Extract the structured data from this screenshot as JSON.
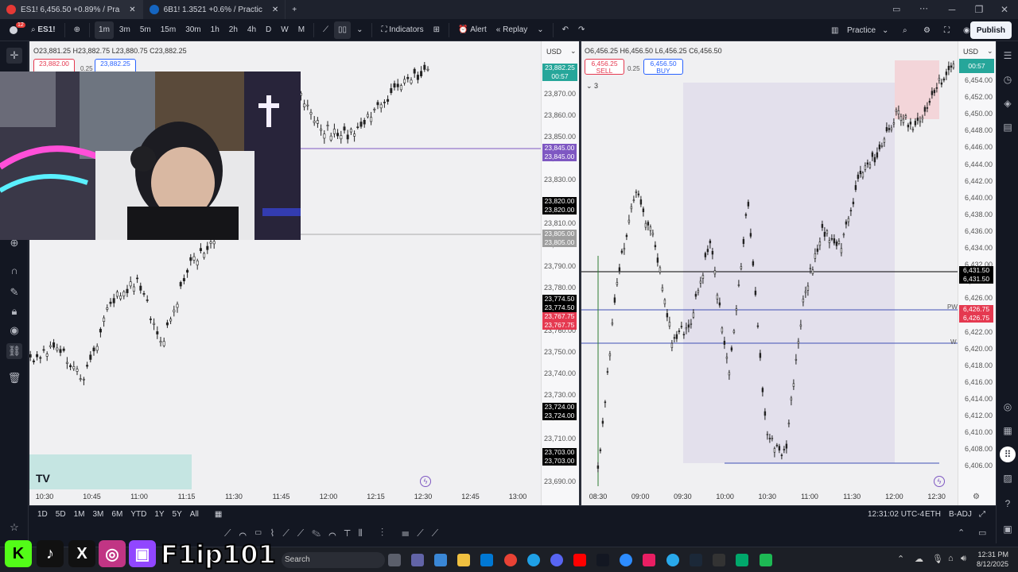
{
  "browser": {
    "tabs": [
      {
        "title": "ES1! 6,456.50 +0.89% / Pra",
        "badge": "500"
      },
      {
        "title": "6B1! 1.3521 +0.6% / Practic"
      }
    ],
    "new_tab": "+"
  },
  "toolbar": {
    "notif_count": "12",
    "symbol": "ES1!",
    "intervals": [
      "1m",
      "3m",
      "5m",
      "15m",
      "30m",
      "1h",
      "2h",
      "4h",
      "D",
      "W",
      "M"
    ],
    "selected_interval": "1m",
    "indicators": "Indicators",
    "alert": "Alert",
    "replay": "Replay",
    "practice": "Practice",
    "publish": "Publish"
  },
  "left_chart": {
    "ohlc": "O23,881.25  H23,882.75  L23,880.75  C23,882.25",
    "sell_price": "23,882.00",
    "buy_price": "23,882.25",
    "spread": "0.25",
    "currency": "USD",
    "last_price": "23,882.25",
    "countdown": "00:57",
    "price_labels": [
      "23,870.00",
      "23,860.00",
      "23,850.00",
      "23,840.00",
      "23,830.00",
      "23,820.00",
      "23,810.00",
      "23,800.00",
      "23,790.00",
      "23,780.00",
      "23,770.00",
      "23,760.00",
      "23,750.00",
      "23,740.00",
      "23,730.00",
      "23,720.00",
      "23,710.00",
      "23,700.00",
      "23,690.00"
    ],
    "tags": [
      {
        "text": "23,845.00",
        "color": "#7e57c2",
        "row": 0
      },
      {
        "text": "23,845.00",
        "color": "#7e57c2",
        "row": 1
      },
      {
        "text": "23,820.00",
        "color": "#000000",
        "row": 0
      },
      {
        "text": "23,820.00",
        "color": "#000000",
        "row": 1
      },
      {
        "text": "23,805.00",
        "color": "#9e9e9e",
        "row": 0
      },
      {
        "text": "23,805.00",
        "color": "#9e9e9e",
        "row": 1
      },
      {
        "text": "23,774.50",
        "color": "#000000",
        "row": 0
      },
      {
        "text": "23,774.50",
        "color": "#000000",
        "row": 1
      },
      {
        "text": "23,767.75",
        "color": "#e53950",
        "row": 0
      },
      {
        "text": "23,767.75",
        "color": "#e53950",
        "row": 1
      },
      {
        "text": "23,724.00",
        "color": "#000000",
        "row": 0
      },
      {
        "text": "23,724.00",
        "color": "#000000",
        "row": 1
      },
      {
        "text": "23,703.00",
        "color": "#000000",
        "row": 0
      },
      {
        "text": "23,703.00",
        "color": "#000000",
        "row": 1
      }
    ],
    "times": [
      "10:30",
      "10:45",
      "11:00",
      "11:15",
      "11:30",
      "11:45",
      "12:00",
      "12:15",
      "12:30",
      "12:45",
      "13:00"
    ],
    "tv_logo": "TV"
  },
  "right_chart": {
    "ohlc": "O6,456.25  H6,456.50  L6,456.25  C6,456.50",
    "sell_price": "6,456.25",
    "buy_price": "6,456.50",
    "sell_label": "SELL",
    "buy_label": "BUY",
    "spread": "0.25",
    "collapse": "3",
    "currency": "USD",
    "countdown": "00:57",
    "price_labels": [
      "6,454.00",
      "6,452.00",
      "6,450.00",
      "6,448.00",
      "6,446.00",
      "6,444.00",
      "6,442.00",
      "6,440.00",
      "6,438.00",
      "6,436.00",
      "6,434.00",
      "6,432.00",
      "6,428.00",
      "6,426.00",
      "6,424.00",
      "6,422.00",
      "6,420.00",
      "6,418.00",
      "6,416.00",
      "6,414.00",
      "6,412.00",
      "6,410.00",
      "6,408.00",
      "6,406.00"
    ],
    "tags": [
      {
        "text": "6,431.50",
        "color": "#000000"
      },
      {
        "text": "6,431.50",
        "color": "#000000"
      },
      {
        "text": "6,426.75",
        "color": "#e53950"
      },
      {
        "text": "6,426.75",
        "color": "#e53950"
      }
    ],
    "line_labels": [
      "PW",
      "W"
    ],
    "times": [
      "08:30",
      "09:00",
      "09:30",
      "10:00",
      "10:30",
      "11:00",
      "11:30",
      "12:00",
      "12:30"
    ]
  },
  "bottom_bar": {
    "ranges": [
      "1D",
      "5D",
      "1M",
      "3M",
      "6M",
      "YTD",
      "1Y",
      "5Y",
      "All"
    ],
    "clock": "12:31:02 UTC-4",
    "session": "ETH",
    "adj": "B-ADJ"
  },
  "taskbar": {
    "search": "Search",
    "time": "12:31 PM",
    "date": "8/12/2025"
  },
  "overlay": {
    "streamer_name": "F1ip101"
  }
}
